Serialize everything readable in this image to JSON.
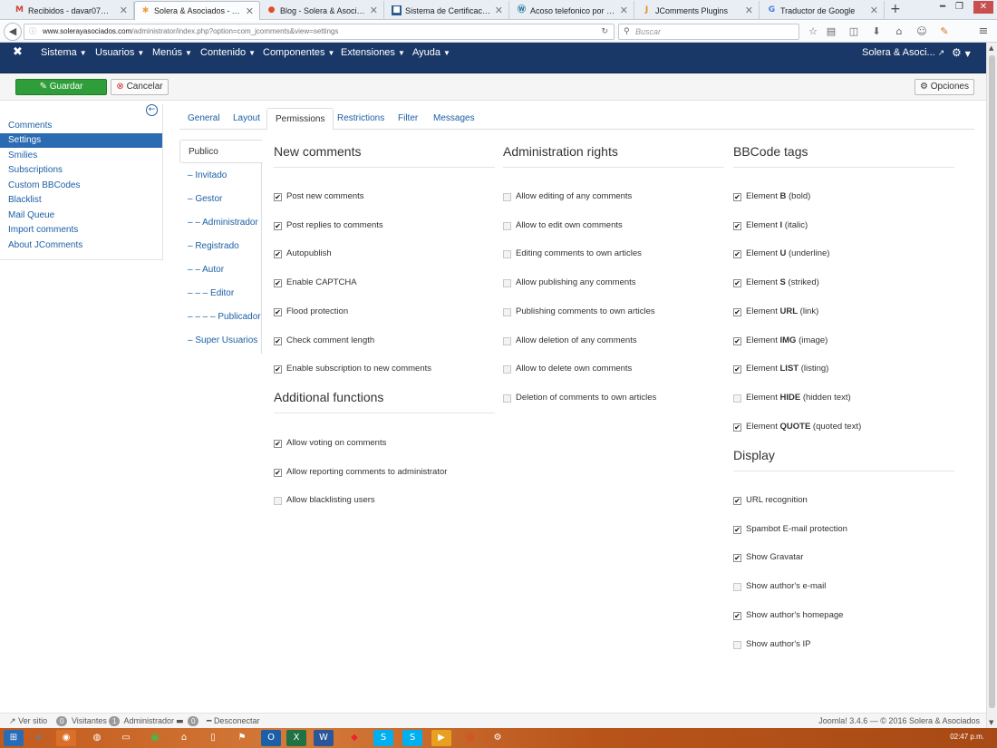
{
  "browser": {
    "tabs": [
      {
        "label": "Recibidos - davar07@g...",
        "icon": "gmail-icon",
        "active": false
      },
      {
        "label": "Solera & Asociados - Ad...",
        "icon": "joomla-icon",
        "active": true
      },
      {
        "label": "Blog - Solera & Asociados",
        "icon": "blog-icon",
        "active": false
      },
      {
        "label": "Sistema de Certificacion...",
        "icon": "site-icon",
        "active": false
      },
      {
        "label": "Acoso telefonico por de...",
        "icon": "wordpress-icon",
        "active": false
      },
      {
        "label": "JComments Plugins",
        "icon": "jcomments-icon",
        "active": false
      },
      {
        "label": "Traductor de Google",
        "icon": "google-translate-icon",
        "active": false
      }
    ],
    "url_domain": "www.solerayasociados.com",
    "url_path": "/administrator/index.php?option=com_jcomments&view=settings",
    "search_placeholder": "Buscar"
  },
  "jmenu": {
    "items": [
      "Sistema",
      "Usuarios",
      "Menús",
      "Contenido",
      "Componentes",
      "Extensiones",
      "Ayuda"
    ],
    "site_name": "Solera & Asoci..."
  },
  "toolbar": {
    "save_label": "Guardar",
    "cancel_label": "Cancelar",
    "options_label": "Opciones"
  },
  "sidebar": {
    "items": [
      {
        "label": "Comments",
        "active": false
      },
      {
        "label": "Settings",
        "active": true
      },
      {
        "label": "Smilies",
        "active": false
      },
      {
        "label": "Subscriptions",
        "active": false
      },
      {
        "label": "Custom BBCodes",
        "active": false
      },
      {
        "label": "Blacklist",
        "active": false
      },
      {
        "label": "Mail Queue",
        "active": false
      },
      {
        "label": "Import comments",
        "active": false
      },
      {
        "label": "About JComments",
        "active": false
      }
    ]
  },
  "tabs": [
    {
      "label": "General",
      "active": false
    },
    {
      "label": "Layout",
      "active": false
    },
    {
      "label": "Permissions",
      "active": true
    },
    {
      "label": "Restrictions",
      "active": false
    },
    {
      "label": "Filter",
      "active": false
    },
    {
      "label": "Messages",
      "active": false
    }
  ],
  "groups": [
    {
      "label": "Publico",
      "active": true
    },
    {
      "label": "– Invitado",
      "active": false
    },
    {
      "label": "– Gestor",
      "active": false
    },
    {
      "label": "– – Administrador",
      "active": false
    },
    {
      "label": "– Registrado",
      "active": false
    },
    {
      "label": "– – Autor",
      "active": false
    },
    {
      "label": "– – – Editor",
      "active": false
    },
    {
      "label": "– – – – Publicador",
      "active": false
    },
    {
      "label": "– Super Usuarios",
      "active": false
    }
  ],
  "sections": {
    "new_comments": {
      "title": "New comments",
      "items": [
        {
          "pre": "Post new comments",
          "bold": "",
          "post": "",
          "checked": true
        },
        {
          "pre": "Post replies to comments",
          "bold": "",
          "post": "",
          "checked": true
        },
        {
          "pre": "Autopublish",
          "bold": "",
          "post": "",
          "checked": true
        },
        {
          "pre": "Enable CAPTCHA",
          "bold": "",
          "post": "",
          "checked": true
        },
        {
          "pre": "Flood protection",
          "bold": "",
          "post": "",
          "checked": true
        },
        {
          "pre": "Check comment length",
          "bold": "",
          "post": "",
          "checked": true
        },
        {
          "pre": "Enable subscription to new comments",
          "bold": "",
          "post": "",
          "checked": true
        }
      ]
    },
    "additional": {
      "title": "Additional functions",
      "items": [
        {
          "pre": "Allow voting on comments",
          "bold": "",
          "post": "",
          "checked": true
        },
        {
          "pre": "Allow reporting comments to administrator",
          "bold": "",
          "post": "",
          "checked": true
        },
        {
          "pre": "Allow blacklisting users",
          "bold": "",
          "post": "",
          "checked": false
        }
      ]
    },
    "admin_rights": {
      "title": "Administration rights",
      "items": [
        {
          "pre": "Allow editing of any comments",
          "bold": "",
          "post": "",
          "checked": false
        },
        {
          "pre": "Allow to edit own comments",
          "bold": "",
          "post": "",
          "checked": false
        },
        {
          "pre": "Editing comments to own articles",
          "bold": "",
          "post": "",
          "checked": false
        },
        {
          "pre": "Allow publishing any comments",
          "bold": "",
          "post": "",
          "checked": false
        },
        {
          "pre": "Publishing comments to own articles",
          "bold": "",
          "post": "",
          "checked": false
        },
        {
          "pre": "Allow deletion of any comments",
          "bold": "",
          "post": "",
          "checked": false
        },
        {
          "pre": "Allow to delete own comments",
          "bold": "",
          "post": "",
          "checked": false
        },
        {
          "pre": "Deletion of comments to own articles",
          "bold": "",
          "post": "",
          "checked": false
        }
      ]
    },
    "bbcode": {
      "title": "BBCode tags",
      "items": [
        {
          "pre": "Element ",
          "bold": "B",
          "post": " (bold)",
          "checked": true
        },
        {
          "pre": "Element ",
          "bold": "I",
          "post": " (italic)",
          "checked": true
        },
        {
          "pre": "Element ",
          "bold": "U",
          "post": " (underline)",
          "checked": true
        },
        {
          "pre": "Element ",
          "bold": "S",
          "post": " (striked)",
          "checked": true
        },
        {
          "pre": "Element ",
          "bold": "URL",
          "post": " (link)",
          "checked": true
        },
        {
          "pre": "Element ",
          "bold": "IMG",
          "post": " (image)",
          "checked": true
        },
        {
          "pre": "Element ",
          "bold": "LIST",
          "post": " (listing)",
          "checked": true
        },
        {
          "pre": "Element ",
          "bold": "HIDE",
          "post": " (hidden text)",
          "checked": false
        },
        {
          "pre": "Element ",
          "bold": "QUOTE",
          "post": " (quoted text)",
          "checked": true
        }
      ]
    },
    "display": {
      "title": "Display",
      "items": [
        {
          "pre": "URL recognition",
          "bold": "",
          "post": "",
          "checked": true
        },
        {
          "pre": "Spambot E-mail protection",
          "bold": "",
          "post": "",
          "checked": true
        },
        {
          "pre": "Show Gravatar",
          "bold": "",
          "post": "",
          "checked": true
        },
        {
          "pre": "Show author's e-mail",
          "bold": "",
          "post": "",
          "checked": false
        },
        {
          "pre": "Show author's homepage",
          "bold": "",
          "post": "",
          "checked": true
        },
        {
          "pre": "Show author's IP",
          "bold": "",
          "post": "",
          "checked": false
        }
      ]
    }
  },
  "status": {
    "view_site": "Ver sitio",
    "visitors_count": "0",
    "visitors_label": "Visitantes",
    "admin_count": "1",
    "admin_label": "Administrador",
    "messages_count": "0",
    "logout": "Desconectar",
    "footer": "Joomla! 3.4.6 — © 2016 Solera & Asociados"
  },
  "taskbar": {
    "clock": "02:47 p.m."
  },
  "colors": {
    "joomla_nav": "#1a3867",
    "save_green": "#2f9e3a",
    "link_blue": "#1c5fa5",
    "active_sidebar": "#2b6bb2"
  }
}
